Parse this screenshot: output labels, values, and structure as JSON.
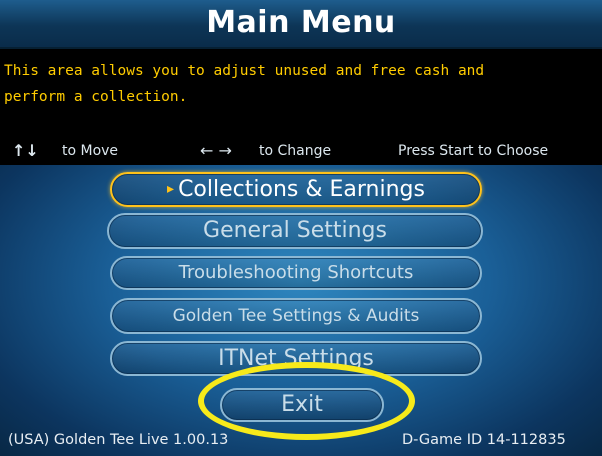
{
  "header": {
    "title": "Main Menu"
  },
  "description": {
    "line1": "This area allows you to adjust unused and free cash and",
    "line2": "perform a collection."
  },
  "hints": {
    "move_icon": "up-down-arrows-icon",
    "move": "to Move",
    "change_icon": "left-right-arrows-icon",
    "change": "to Change",
    "choose": "Press Start to Choose"
  },
  "menu": {
    "items": [
      {
        "label": "Collections & Earnings",
        "selected": true
      },
      {
        "label": "General Settings"
      },
      {
        "label": "Troubleshooting Shortcuts"
      },
      {
        "label": "Golden Tee Settings & Audits"
      },
      {
        "label": "ITNet Settings"
      },
      {
        "label": "Exit"
      }
    ]
  },
  "footer": {
    "version": "(USA) Golden Tee Live 1.00.13",
    "game_id": "D-Game ID 14-112835"
  },
  "colors": {
    "accent": "#ffc21a",
    "description_text": "#ffcc00",
    "highlight_ring": "#f7ea1a",
    "button_border": "#8bb7d3"
  }
}
